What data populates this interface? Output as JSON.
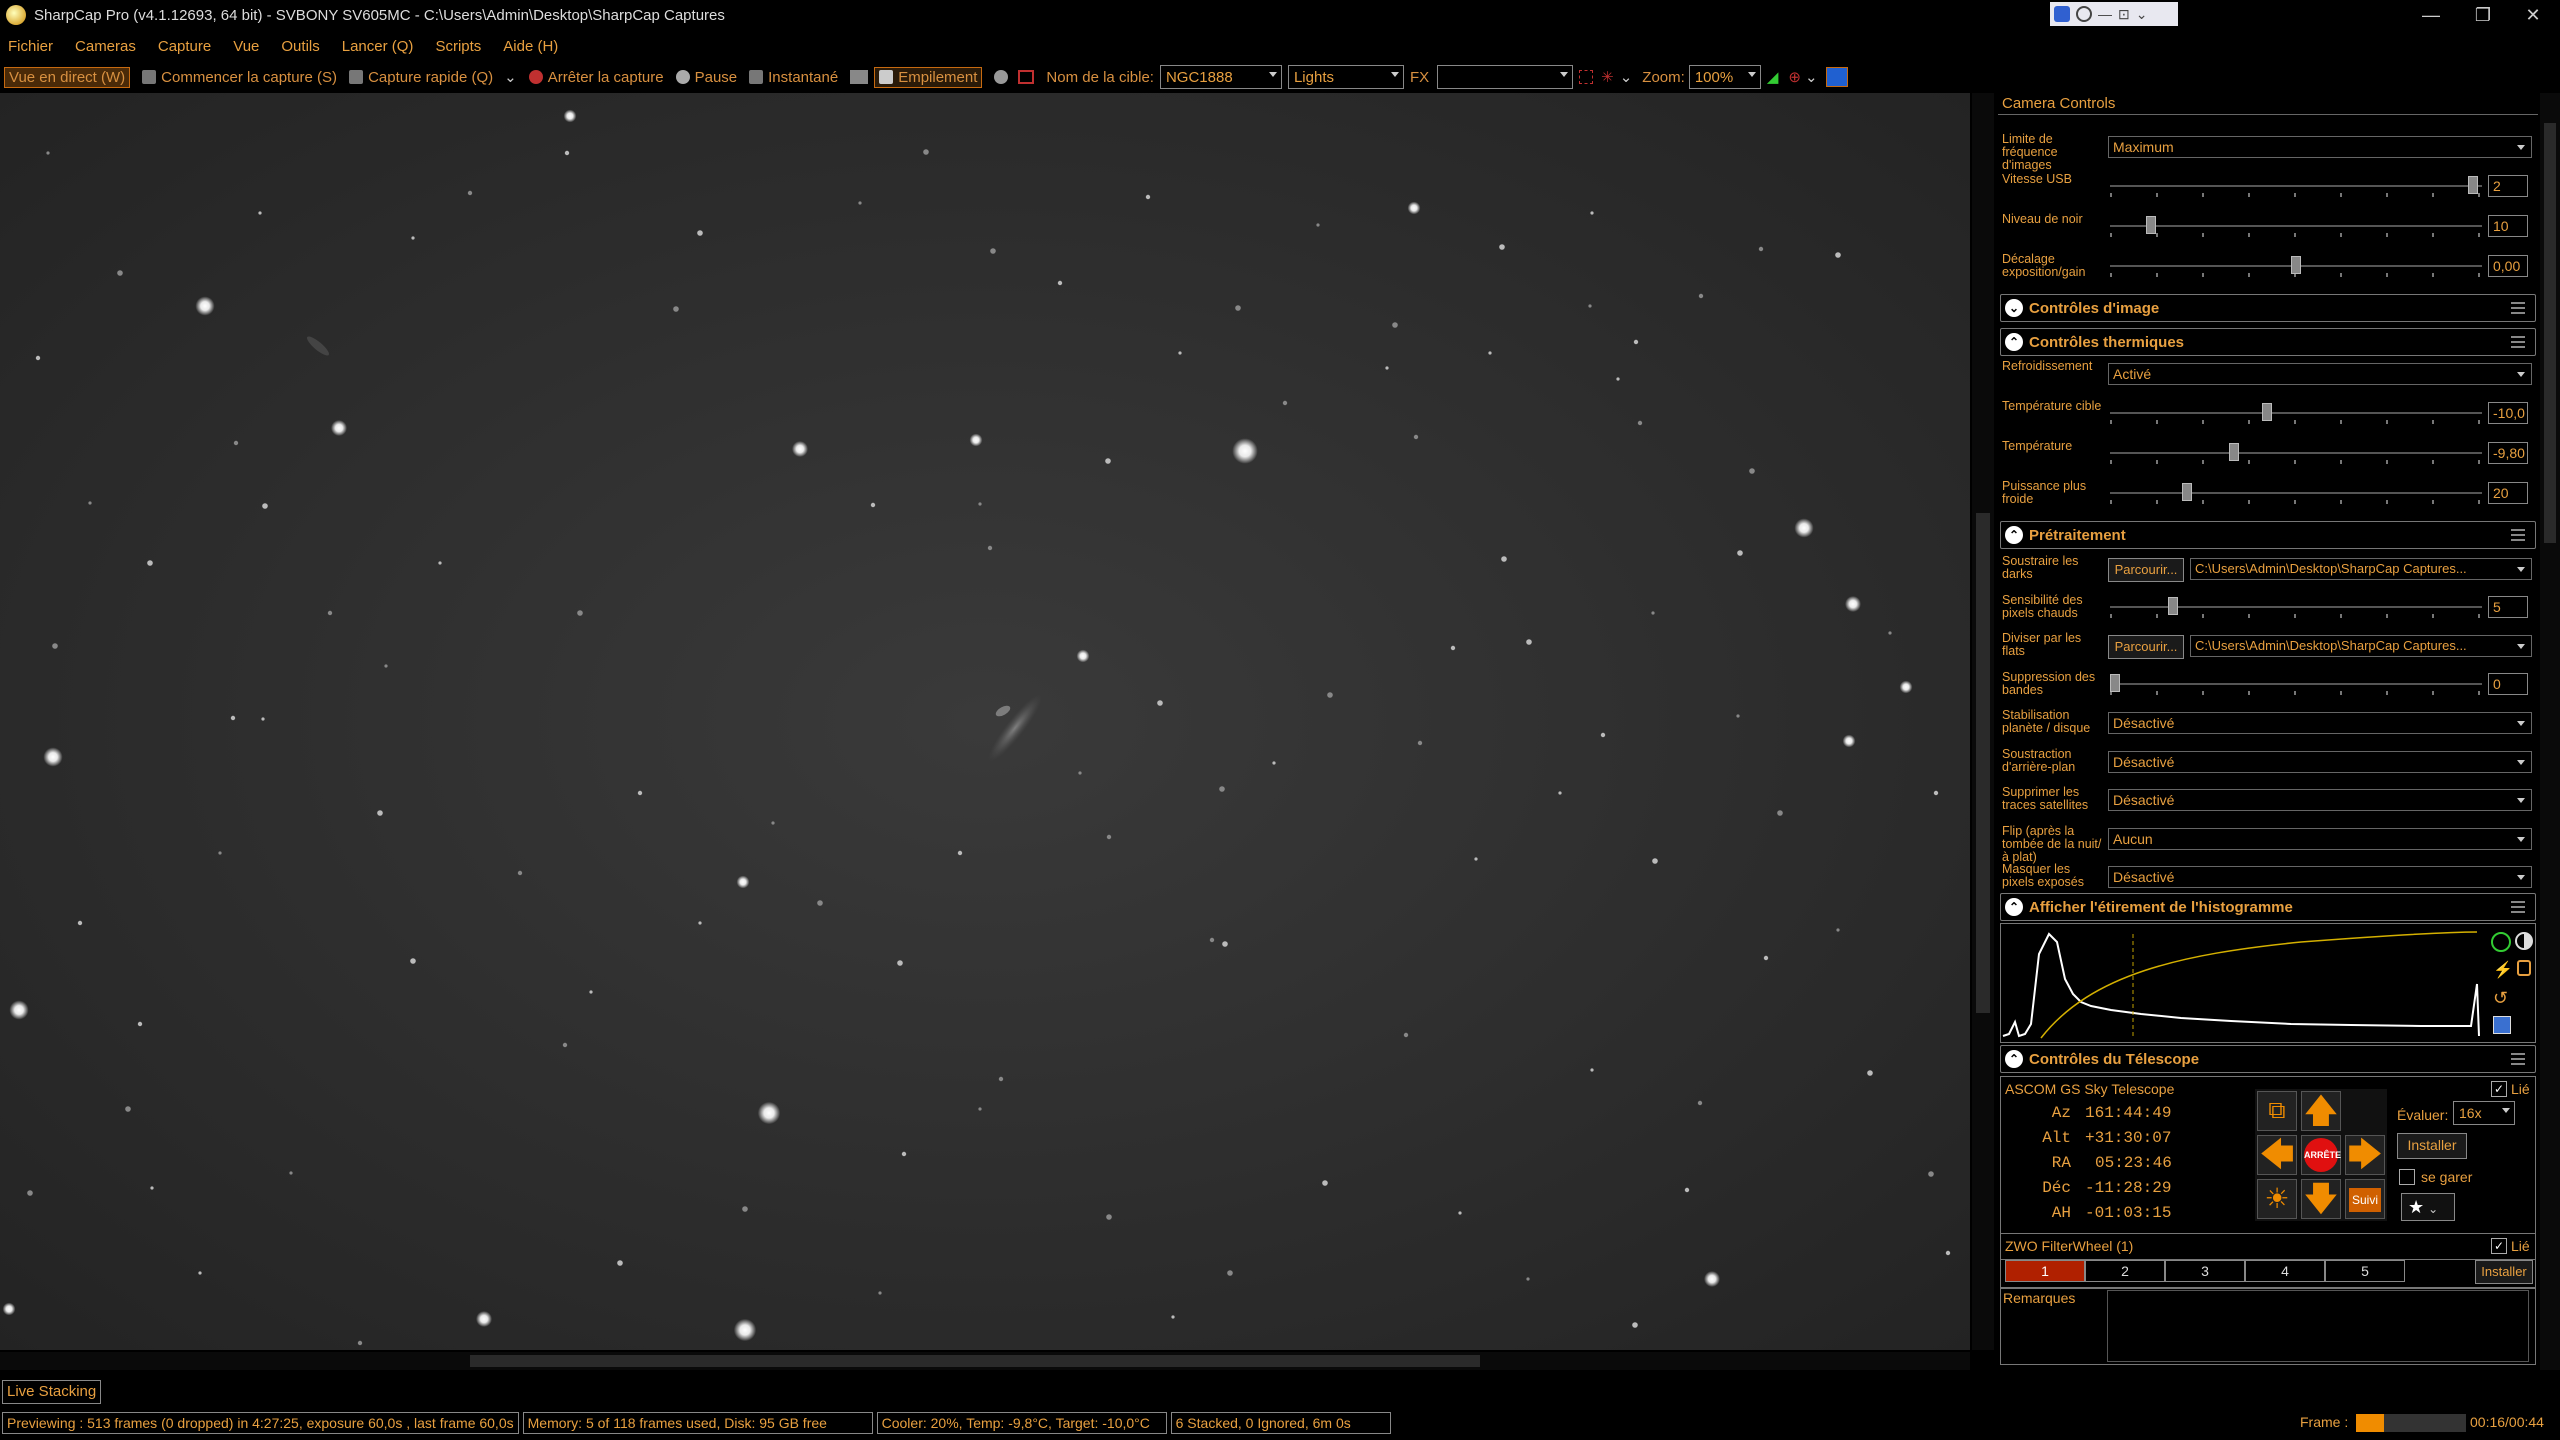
{
  "window": {
    "title": "SharpCap Pro (v4.1.12693, 64 bit) - SVBONY SV605MC - C:\\Users\\Admin\\Desktop\\SharpCap Captures"
  },
  "menu": [
    "Fichier",
    "Cameras",
    "Capture",
    "Vue",
    "Outils",
    "Lancer (Q)",
    "Scripts",
    "Aide (H)"
  ],
  "toolbar": {
    "live_view": "Vue en direct (W)",
    "start_capture": "Commencer la capture (S)",
    "quick_capture": "Capture rapide (Q)",
    "stop_capture": "Arrêter la capture",
    "pause": "Pause",
    "snapshot": "Instantané",
    "stacking": "Empilement",
    "target_label": "Nom de la cible:",
    "target_value": "NGC1888",
    "frame_type": "Lights",
    "fx_label": "FX",
    "fx_value": "",
    "zoom_label": "Zoom:",
    "zoom_value": "100%"
  },
  "panel": {
    "header": "Camera Controls",
    "camera_rows": [
      {
        "label": "Limite de fréquence d'images",
        "type": "select",
        "value": "Maximum"
      },
      {
        "label": "Vitesse USB",
        "type": "slider",
        "value": "2",
        "level": 0.99
      },
      {
        "label": "Niveau de noir",
        "type": "slider",
        "value": "10",
        "level": 0.1
      },
      {
        "label": "Décalage exposition/gain",
        "type": "slider",
        "value": "0,00",
        "level": 0.5
      }
    ],
    "sections": {
      "image": "Contrôles d'image",
      "thermal": "Contrôles thermiques",
      "preprocessing": "Prétraitement",
      "histogram": "Afficher l'étirement de l'histogramme",
      "telescope": "Contrôles du Télescope"
    },
    "thermal_rows": [
      {
        "label": "Refroidissement",
        "type": "select",
        "value": "Activé"
      },
      {
        "label": "Température cible",
        "type": "slider",
        "value": "-10,0",
        "level": 0.42
      },
      {
        "label": "Température",
        "type": "slider",
        "value": "-9,80",
        "level": 0.33
      },
      {
        "label": "Puissance plus froide",
        "type": "slider",
        "value": "20",
        "level": 0.2
      }
    ],
    "pre_rows": [
      {
        "label": "Soustraire les darks",
        "type": "file",
        "button": "Parcourir...",
        "value": "C:\\Users\\Admin\\Desktop\\SharpCap Captures..."
      },
      {
        "label": "Sensibilité des pixels chauds",
        "type": "slider",
        "value": "5",
        "level": 0.16
      },
      {
        "label": "Diviser par les flats",
        "type": "file",
        "button": "Parcourir...",
        "value": "C:\\Users\\Admin\\Desktop\\SharpCap Captures..."
      },
      {
        "label": "Suppression des bandes",
        "type": "slider",
        "value": "0",
        "level": 0.0
      },
      {
        "label": "Stabilisation planète / disque",
        "type": "select",
        "value": "Désactivé"
      },
      {
        "label": "Soustraction d'arrière-plan",
        "type": "select",
        "value": "Désactivé"
      },
      {
        "label": "Supprimer les traces satellites",
        "type": "select",
        "value": "Désactivé"
      },
      {
        "label": "Flip (après la tombée de la nuit/à plat)",
        "type": "select",
        "value": "Aucun"
      },
      {
        "label": "Masquer les pixels exposés",
        "type": "select",
        "value": "Désactivé"
      }
    ],
    "telescope": {
      "name": "ASCOM GS Sky Telescope",
      "linked_label": "Lié",
      "az_label": "Az",
      "az": "161:44:49",
      "alt_label": "Alt",
      "alt": "+31:30:07",
      "ra_label": "RA",
      "ra": "05:23:46",
      "dec_label": "Déc",
      "dec": "-11:28:29",
      "ah_label": "AH",
      "ah": "-01:03:15",
      "rate_label": "Évaluer:",
      "rate_value": "16x",
      "stop_label": "ARRÊTE",
      "install_label": "Installer",
      "park_label": "se garer",
      "track_label": "Suivi"
    },
    "filterwheel": {
      "name": "ZWO FilterWheel (1)",
      "linked_label": "Lié",
      "slots": [
        "1",
        "2",
        "3",
        "4",
        "5"
      ],
      "active_slot": "1",
      "install_label": "Installer"
    },
    "notes_label": "Remarques"
  },
  "live_stacking_tab": "Live Stacking",
  "status": {
    "preview": "Previewing : 513 frames (0 dropped) in 4:27:25, exposure 60,0s , last frame 60,0s",
    "memory": "Memory: 5 of 118 frames used, Disk: 95 GB free",
    "cooler": "Cooler: 20%, Temp: -9,8°C, Target: -10,0°C",
    "stacked": "6 Stacked, 0 Ignored, 6m 0s",
    "frame_label": "Frame :",
    "frame_progress": 0.25,
    "time": "00:16/00:44"
  },
  "colors": {
    "accent": "#e8a040",
    "border_accent": "#c76a10",
    "arrow": "#f08c00",
    "stop": "#e01010",
    "filter_active": "#b02000"
  },
  "icons": {
    "nav_up": "arrow-up-icon",
    "nav_down": "arrow-down-icon",
    "nav_left": "arrow-left-icon",
    "nav_right": "arrow-right-icon"
  }
}
